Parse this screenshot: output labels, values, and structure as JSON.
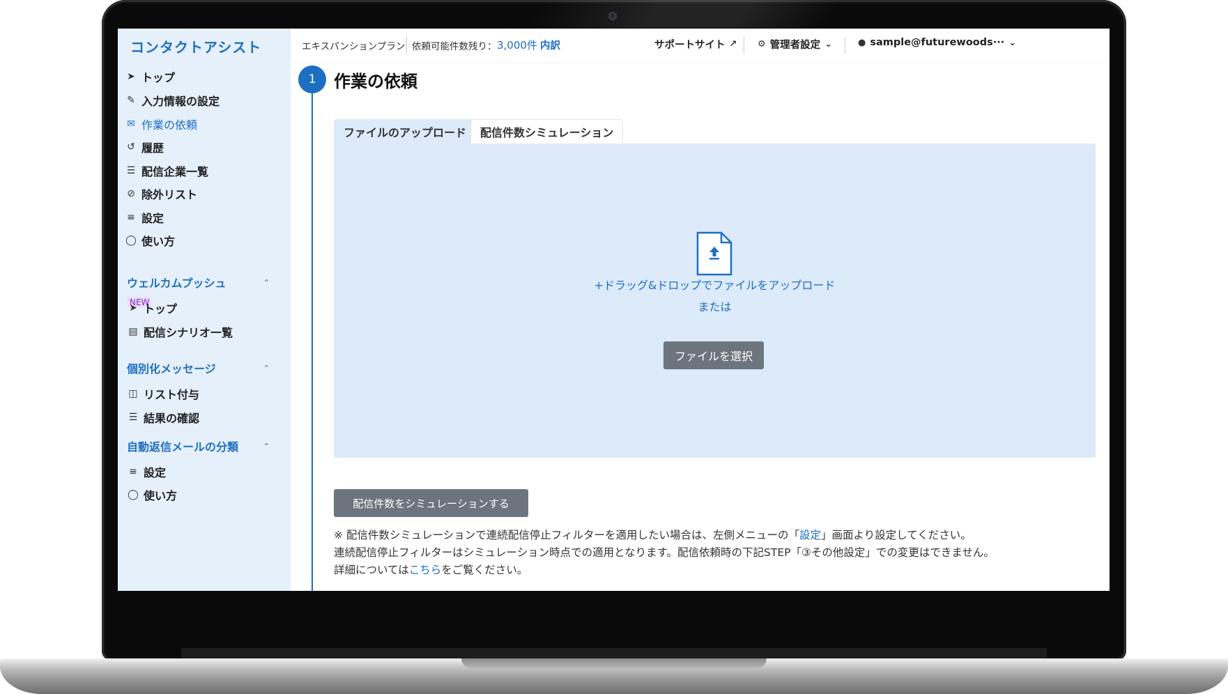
{
  "app": {
    "name": "コンタクトアシスト"
  },
  "header": {
    "plan": "エキスパンションプラン",
    "quota_label": "依頼可能件数残り：",
    "quota_value": "3,000件",
    "breakdown_link": "内訳",
    "support_site": "サポートサイト",
    "admin_settings": "管理者設定",
    "user_email": "sample@futurewoods···"
  },
  "sidebar": {
    "main_items": [
      {
        "label": "トップ",
        "icon": "send-icon"
      },
      {
        "label": "入力情報の設定",
        "icon": "edit-icon"
      },
      {
        "label": "作業の依頼",
        "icon": "mail-icon",
        "active": true
      },
      {
        "label": "履歴",
        "icon": "history-icon"
      },
      {
        "label": "配信企業一覧",
        "icon": "list-icon"
      },
      {
        "label": "除外リスト",
        "icon": "ban-icon"
      },
      {
        "label": "設定",
        "icon": "sliders-icon"
      },
      {
        "label": "使い方",
        "icon": "lightbulb-icon"
      }
    ],
    "new_badge": "NEW",
    "welcome_push": {
      "title": "ウェルカムプッシュ",
      "items": [
        {
          "label": "トップ",
          "icon": "send-icon"
        },
        {
          "label": "配信シナリオ一覧",
          "icon": "table-list-icon"
        }
      ]
    },
    "personalized": {
      "title": "個別化メッセージ",
      "items": [
        {
          "label": "リスト付与",
          "icon": "file-plus-icon"
        },
        {
          "label": "結果の確認",
          "icon": "list-icon"
        }
      ]
    },
    "auto_reply": {
      "title": "自動返信メールの分類",
      "items": [
        {
          "label": "設定",
          "icon": "sliders-icon"
        },
        {
          "label": "使い方",
          "icon": "lightbulb-icon"
        }
      ]
    }
  },
  "main": {
    "step_number": "1",
    "title": "作業の依頼",
    "tabs": [
      {
        "label": "ファイルのアップロード",
        "active": true
      },
      {
        "label": "配信件数シミュレーション",
        "active": false
      }
    ],
    "dropzone": {
      "drag_text": "+ドラッグ&ドロップでファイルをアップロード",
      "or_text": "または",
      "select_button": "ファイルを選択",
      "icon": "file-upload-icon"
    },
    "simulate_button": "配信件数をシミュレーションする",
    "notes": {
      "line1_a": "※ 配信件数シミュレーションで連続配信停止フィルターを適用したい場合は、左側メニューの「",
      "line1_link": "設定",
      "line1_b": "」画面より設定してください。",
      "line2": "連続配信停止フィルターはシミュレーション時点での適用となります。配信依頼時の下記STEP「③その他設定」での変更はできません。",
      "line3_a": "詳細については",
      "line3_link": "こちら",
      "line3_b": "をご覧ください。"
    }
  },
  "colors": {
    "accent": "#1c6fc2",
    "sidebar_bg": "#e6f0fb",
    "dropzone_bg": "#dceaf9",
    "button_gray": "#6c757d",
    "badge_purple": "#7b2fbe"
  }
}
